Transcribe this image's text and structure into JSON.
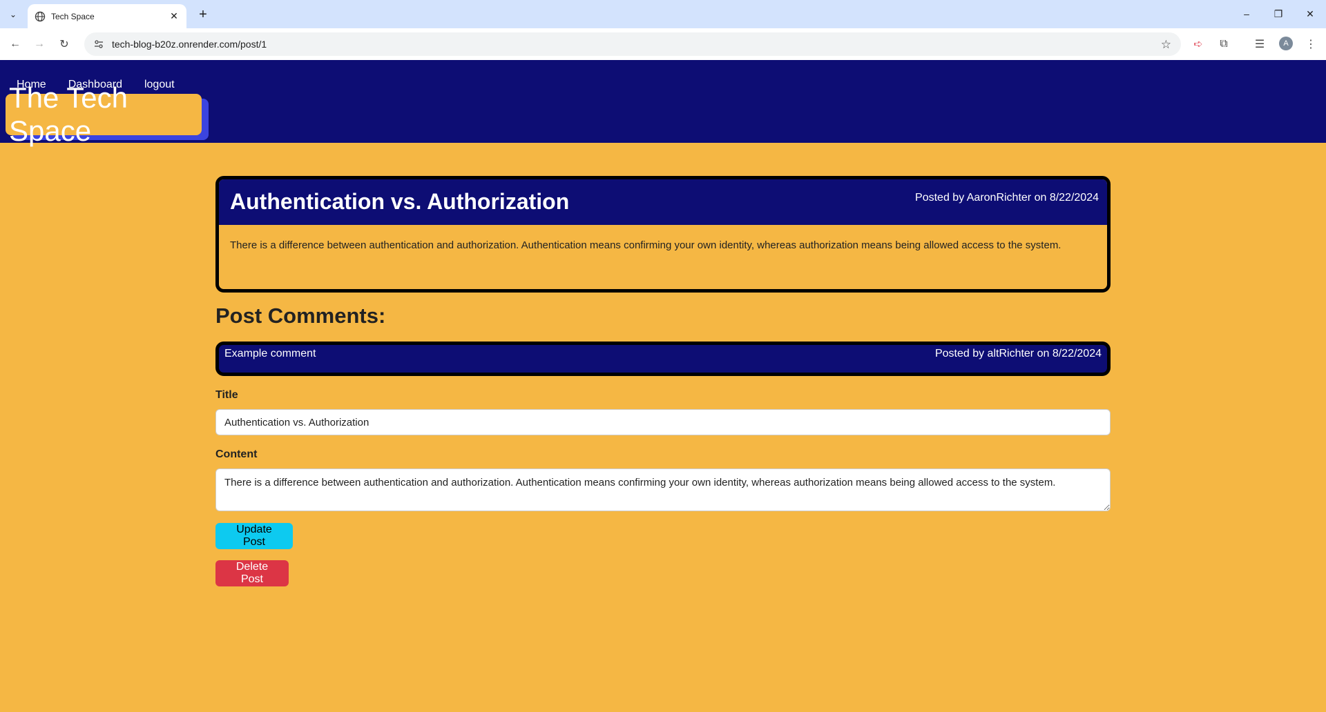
{
  "browser": {
    "tab_title": "Tech Space",
    "url": "tech-blog-b20z.onrender.com/post/1",
    "profile_initial": "A"
  },
  "nav": {
    "home": "Home",
    "dashboard": "Dashboard",
    "logout": "logout"
  },
  "brand": "The Tech Space",
  "post": {
    "title": "Authentication vs. Authorization",
    "meta": "Posted by AaronRichter on 8/22/2024",
    "body": "There is a difference between authentication and authorization. Authentication means confirming your own identity, whereas authorization means being allowed access to the system."
  },
  "comments_heading": "Post Comments:",
  "comments": [
    {
      "text": "Example comment",
      "meta": "Posted by altRichter on 8/22/2024"
    }
  ],
  "form": {
    "title_label": "Title",
    "title_value": "Authentication vs. Authorization",
    "content_label": "Content",
    "content_value": "There is a difference between authentication and authorization. Authentication means confirming your own identity, whereas authorization means being allowed access to the system.",
    "update_label": "Update Post",
    "delete_label": "Delete Post"
  },
  "colors": {
    "header_bg": "#0d0d74",
    "page_bg": "#f5b744",
    "update_btn": "#0dcaf0",
    "delete_btn": "#dc3545"
  }
}
